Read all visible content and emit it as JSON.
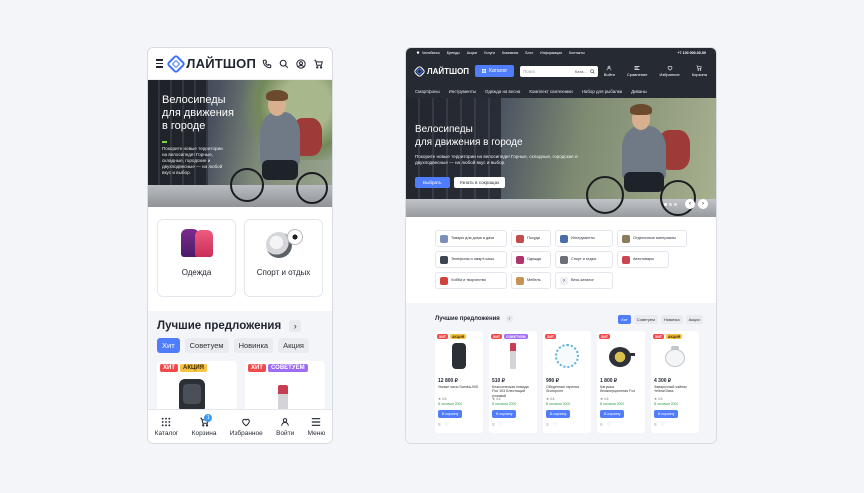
{
  "mobile": {
    "logo": "ЛАЙТШОП",
    "hero": {
      "title": "Велосипеды для движения в городе",
      "subtitle": "Покорите новые территории на велосипеде! Горные, складные, городские и двухподвесные — на любой вкус и выбор."
    },
    "categories": [
      {
        "label": "Одежда"
      },
      {
        "label": "Спорт и отдых"
      }
    ],
    "best": {
      "title": "Лучшие предложения",
      "chips": [
        "Хит",
        "Советуем",
        "Новинка",
        "Акция"
      ]
    },
    "products": [
      {
        "badges": [
          "ХИТ",
          "АКЦИЯ"
        ]
      },
      {
        "badges": [
          "ХИТ",
          "СОВЕТУЕМ"
        ]
      }
    ],
    "tabbar": [
      {
        "label": "Каталог"
      },
      {
        "label": "Корзина",
        "count": "1"
      },
      {
        "label": "Избранное"
      },
      {
        "label": "Войти"
      },
      {
        "label": "Меню"
      }
    ]
  },
  "desktop": {
    "topbar": {
      "city": "Челябинск",
      "links": [
        "Бренды",
        "Акции",
        "Услуги",
        "Компания",
        "Блог",
        "Информация",
        "Контакты"
      ],
      "phone": "+7 100 000-00-00"
    },
    "logo": "ЛАЙТШОП",
    "catalog_button": "Каталог",
    "search": {
      "placeholder": "Поиск",
      "category": "Ката..."
    },
    "actions": [
      "Войти",
      "Сравнение",
      "Избранное",
      "Корзина"
    ],
    "nav": [
      "Смартфоны",
      "Инструменты",
      "Одежда на весна",
      "Комплект сантехники",
      "Набор для рыбалки",
      "Диваны"
    ],
    "hero": {
      "title_line1": "Велосипеды",
      "title_line2": "для движения в городе",
      "subtitle": "Покорите новые территории на велосипеде! Горные, складные, городские и двухподвесные — на любой вкус и выбор.",
      "btn_primary": "Выбрать",
      "btn_secondary": "Узнать в сокращах"
    },
    "categories": [
      {
        "label": "Товары для дома и дачи",
        "color": "#7b90b8"
      },
      {
        "label": "Посуда",
        "color": "#c44b4b"
      },
      {
        "label": "Инструменты",
        "color": "#4a6fa8"
      },
      {
        "label": "Отделочные материалы",
        "color": "#8c7a5c"
      },
      {
        "label": "Телефоны и смарт-часы",
        "color": "#3d4452"
      },
      {
        "label": "Одежда",
        "color": "#b0336a"
      },
      {
        "label": "Спорт и отдых",
        "color": "#6b6f78"
      },
      {
        "label": "Автотовары",
        "color": "#c94550"
      },
      {
        "label": "Хобби и творчество",
        "color": "#d0453b"
      },
      {
        "label": "Мебель",
        "color": "#c69356"
      },
      {
        "label": "Весь каталог",
        "color": "#eef0f4"
      }
    ],
    "best": {
      "title": "Лучшие предложения",
      "chips": [
        "Хит",
        "Советуем",
        "Новинка",
        "Акция"
      ]
    },
    "products": [
      {
        "badges": [
          "ХИТ",
          "АКЦИЯ"
        ],
        "price": "12 800 ₽",
        "name": "Умные часы Samba-005",
        "rating": "4.6",
        "stock": "В наличии 2000",
        "cart": "В корзину"
      },
      {
        "badges": [
          "ХИТ",
          "СОВЕТУЕМ"
        ],
        "price": "510 ₽",
        "name": "Классическая помада Flor 103 Блестящий розовый",
        "rating": "4.6",
        "stock": "В наличии 2000",
        "cart": "В корзину"
      },
      {
        "badges": [
          "ХИТ"
        ],
        "price": "990 ₽",
        "name": "Обеденная тарелка Snowpoint",
        "rating": "4.6",
        "stock": "В наличии 2000",
        "cart": "В корзину"
      },
      {
        "badges": [
          "ХИТ"
        ],
        "price": "1 800 ₽",
        "name": "Катушка безынерционная Fox",
        "rating": "4.6",
        "stock": "В наличии 2000",
        "cart": "В корзину"
      },
      {
        "badges": [
          "ХИТ",
          "АКЦИЯ"
        ],
        "price": "4 300 ₽",
        "name": "Заварочный чайник YellowGlass",
        "rating": "4.6",
        "stock": "В наличии 2000",
        "cart": "В корзину"
      }
    ]
  },
  "colors": {
    "accent": "#4f7dfb",
    "hit": "#f24a4a",
    "sale": "#f8c342",
    "recommend": "#a06cf3",
    "dark": "#262a33"
  }
}
